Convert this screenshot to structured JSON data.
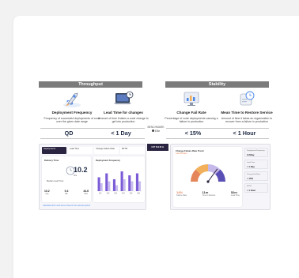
{
  "sections": {
    "throughput": "Throughput",
    "stability": "Stability"
  },
  "metrics": [
    {
      "title": "Deployment Frequency",
      "desc": "Frequency of successful deployments of code over the given date range",
      "value": "QD",
      "icon": "rocket-icon"
    },
    {
      "title": "Lead Time for changes",
      "desc": "Amount of time it takes a code change to get into production",
      "value": "< 1 Day",
      "icon": "laptop-clock-icon"
    },
    {
      "title": "Change Fail Rate",
      "desc": "Percentage of code deployments causing a failure in production",
      "value": "< 15%",
      "icon": "bar-chart-monitor-icon"
    },
    {
      "title": "Mean Time to Restore Service",
      "desc": "Amount of time it takes an organization to recover from a failure in production",
      "value": "< 1 Hour",
      "icon": "restore-clock-icon"
    }
  ],
  "benchmark": {
    "label": "BENCHMARK",
    "level": "Elite"
  },
  "brand": "OPSERA",
  "dashboard1": {
    "tabs": [
      "Deployments",
      "Lead Time",
      "Change Failure Rate",
      "MTTR"
    ],
    "gauge_value": "10.2",
    "gauge_unit": "hrs",
    "gauge_caption": "Median Lead Time",
    "left_panel_title": "Delivery Time",
    "right_panel_title": "Deployment Frequency",
    "footer_note": "Calculated from work items closed in the selected period",
    "stats": [
      {
        "label": "Avg",
        "value": "10.2"
      },
      {
        "label": "Min",
        "value": "0.4"
      },
      {
        "label": "Max",
        "value": "44.6"
      }
    ]
  },
  "dashboard2": {
    "title": "Change Failure Rate Trend",
    "subtitle": "Last 90 days",
    "stats": [
      {
        "value": "14%",
        "label": "Failure Rate"
      },
      {
        "value": "11m",
        "label": "Time to Restore"
      },
      {
        "value": "52m",
        "label": "Lead Time"
      }
    ],
    "side": [
      {
        "label": "Deployment Frequency",
        "value": "3.2/day"
      },
      {
        "label": "Lead Time",
        "value": "< 1 Day"
      },
      {
        "label": "Change Fail Rate",
        "value": "< 15%"
      },
      {
        "label": "MTTR",
        "value": "< 1 Hour"
      }
    ]
  },
  "chart_data": {
    "type": "bar",
    "categories": [
      "W1",
      "W2",
      "W3",
      "W4",
      "W5",
      "W6"
    ],
    "series": [
      {
        "values": [
          7,
          9,
          6,
          10,
          8,
          9
        ],
        "color": "#7b5cd6"
      },
      {
        "values": [
          4,
          5,
          3,
          6,
          5,
          5
        ],
        "color": "#c9bdf0"
      }
    ],
    "ylim": [
      0,
      12
    ]
  },
  "gauge": {
    "segments": [
      "#e5855a",
      "#f2b05b",
      "#c6b9e9",
      "#5a4fb5"
    ],
    "level": 0.7
  }
}
